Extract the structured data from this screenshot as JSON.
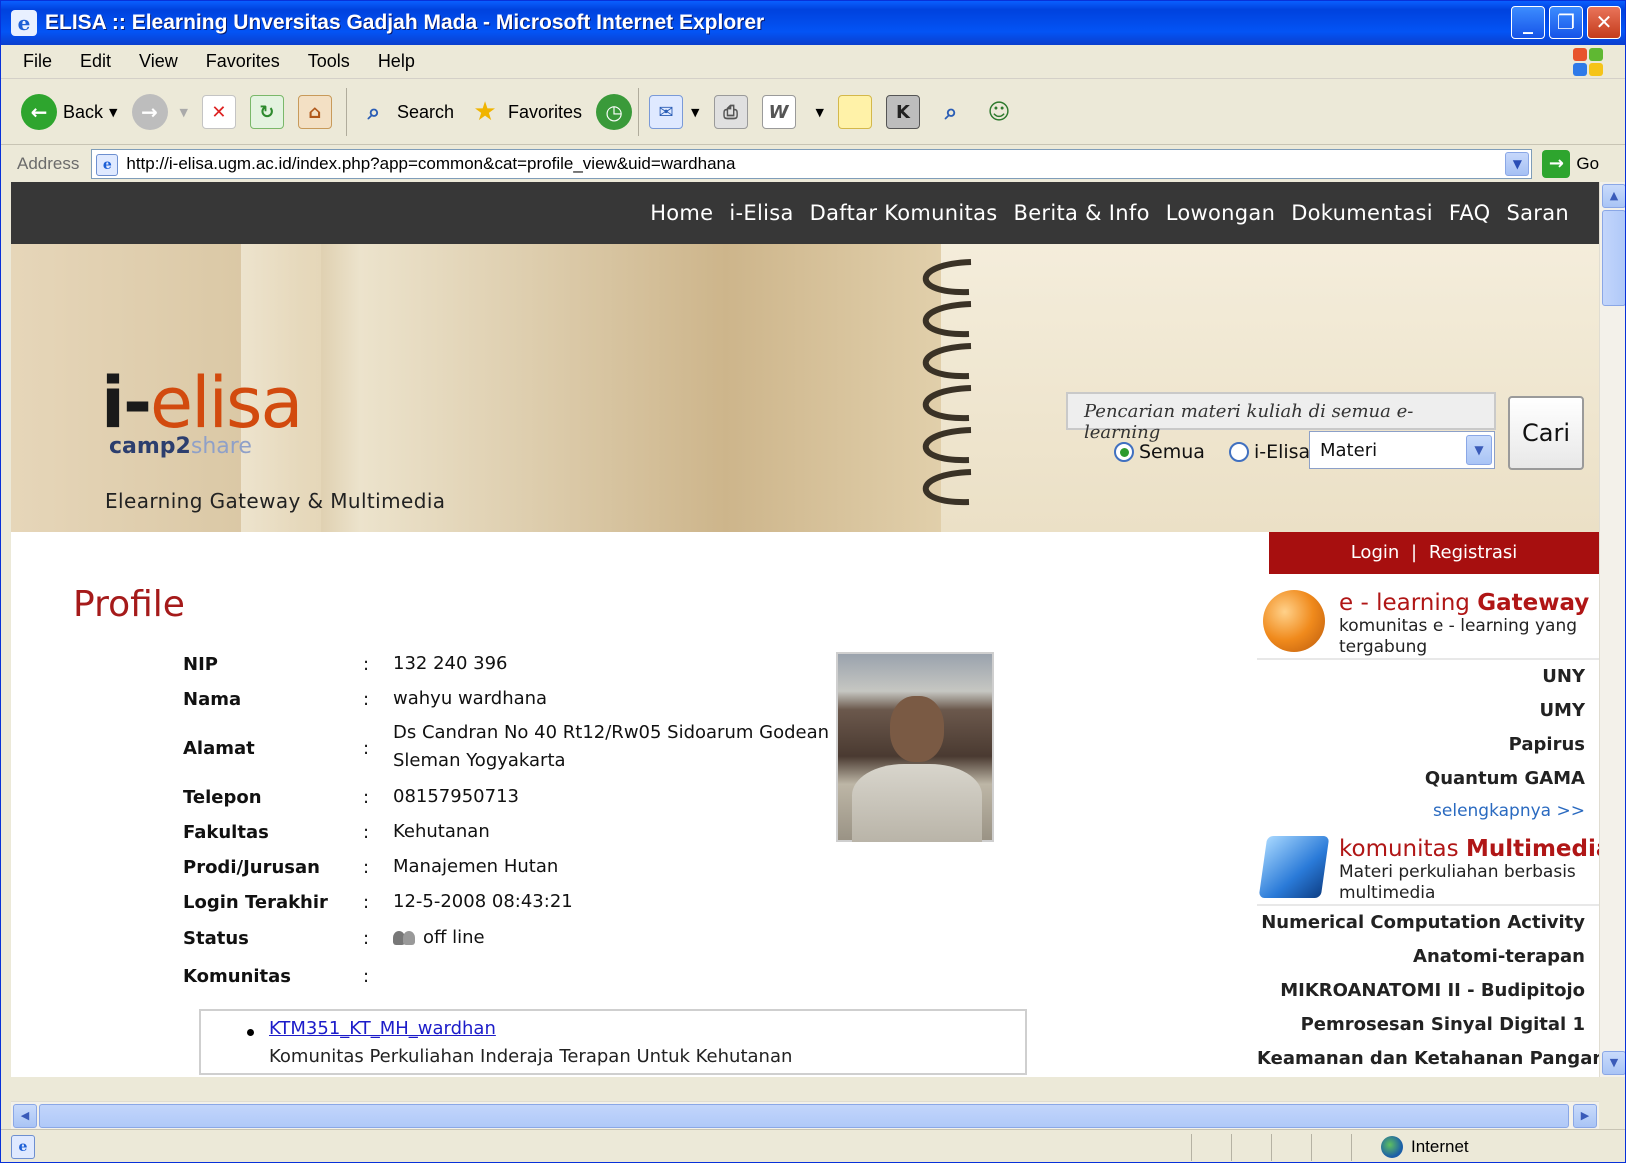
{
  "window": {
    "title": "ELISA :: Elearning Unversitas Gadjah Mada - Microsoft Internet Explorer",
    "minimize": "_",
    "restore": "❐",
    "close": "✕"
  },
  "menu": [
    "File",
    "Edit",
    "View",
    "Favorites",
    "Tools",
    "Help"
  ],
  "toolbar": {
    "back": "Back",
    "search": "Search",
    "favorites": "Favorites"
  },
  "address": {
    "label": "Address",
    "url": "http://i-elisa.ugm.ac.id/index.php?app=common&cat=profile_view&uid=wardhana",
    "go": "Go"
  },
  "site_nav": [
    "Home",
    "i-Elisa",
    "Daftar Komunitas",
    "Berita & Info",
    "Lowongan",
    "Dokumentasi",
    "FAQ",
    "Saran"
  ],
  "banner": {
    "logo_main": "elisa",
    "logo_prefix": "i-",
    "logo_sub_a": "camp2",
    "logo_sub_b": "share",
    "tagline": "Elearning Gateway & Multimedia",
    "search_placeholder": "Pencarian materi kuliah di semua e-learning",
    "radio_semua": "Semua",
    "radio_ielisa": "i-Elisa",
    "select_value": "Materi",
    "search_button": "Cari"
  },
  "auth": {
    "login": "Login",
    "separator": "|",
    "register": "Registrasi"
  },
  "profile": {
    "title": "Profile",
    "colon": ":",
    "fields": [
      {
        "label": "NIP",
        "value": "132 240 396"
      },
      {
        "label": "Nama",
        "value": "wahyu wardhana"
      },
      {
        "label": "Alamat",
        "value": "Ds Candran No 40 Rt12/Rw05 Sidoarum Godean",
        "value2": "Sleman Yogyakarta"
      },
      {
        "label": "Telepon",
        "value": "08157950713"
      },
      {
        "label": "Fakultas",
        "value": "Kehutanan"
      },
      {
        "label": "Prodi/Jurusan",
        "value": "Manajemen Hutan"
      },
      {
        "label": "Login Terakhir",
        "value": "12-5-2008 08:43:21"
      },
      {
        "label": "Status",
        "value": "off line"
      },
      {
        "label": "Komunitas",
        "value": ""
      }
    ],
    "komunitas": {
      "link": "KTM351_KT_MH_wardhan",
      "desc": "Komunitas Perkuliahan Inderaja Terapan Untuk Kehutanan"
    }
  },
  "sidebar": {
    "gateway": {
      "title_a": "e - learning",
      "title_b": "Gateway",
      "subtitle": "komunitas e - learning yang tergabung",
      "items": [
        "UNY",
        "UMY",
        "Papirus",
        "Quantum GAMA"
      ],
      "more": "selengkapnya >>"
    },
    "multimedia": {
      "title_a": "komunitas",
      "title_b": "Multimedia",
      "subtitle": "Materi perkuliahan berbasis multimedia",
      "items": [
        "Numerical Computation Activity",
        "Anatomi-terapan",
        "MIKROANATOMI II - Budipitojo",
        "Pemrosesan Sinyal Digital 1",
        "Keamanan dan Ketahanan Pangan"
      ]
    }
  },
  "statusbar": {
    "zone": "Internet"
  }
}
